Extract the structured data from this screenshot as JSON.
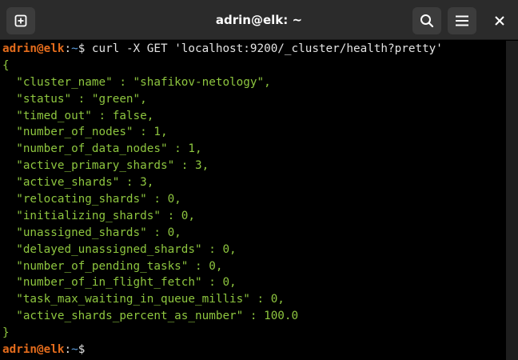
{
  "window": {
    "title": "adrin@elk: ~"
  },
  "icons": {
    "new_tab": "new-tab-icon",
    "search": "search-icon",
    "menu": "hamburger-menu-icon",
    "close": "close-icon"
  },
  "colors": {
    "prompt_user": "#e46c1c",
    "prompt_path": "#5c9fe0",
    "output_text": "#8ec63f",
    "command_text": "#e3e3e3",
    "background": "#000000"
  },
  "terminal": {
    "prompt1": {
      "user_host": "adrin@elk",
      "colon": ":",
      "path": "~",
      "symbol": "$ ",
      "command": "curl -X GET 'localhost:9200/_cluster/health?pretty'"
    },
    "output": [
      "{",
      "  \"cluster_name\" : \"shafikov-netology\",",
      "  \"status\" : \"green\",",
      "  \"timed_out\" : false,",
      "  \"number_of_nodes\" : 1,",
      "  \"number_of_data_nodes\" : 1,",
      "  \"active_primary_shards\" : 3,",
      "  \"active_shards\" : 3,",
      "  \"relocating_shards\" : 0,",
      "  \"initializing_shards\" : 0,",
      "  \"unassigned_shards\" : 0,",
      "  \"delayed_unassigned_shards\" : 0,",
      "  \"number_of_pending_tasks\" : 0,",
      "  \"number_of_in_flight_fetch\" : 0,",
      "  \"task_max_waiting_in_queue_millis\" : 0,",
      "  \"active_shards_percent_as_number\" : 100.0",
      "}"
    ],
    "prompt2": {
      "user_host": "adrin@elk",
      "colon": ":",
      "path": "~",
      "symbol": "$ ",
      "command": ""
    }
  }
}
